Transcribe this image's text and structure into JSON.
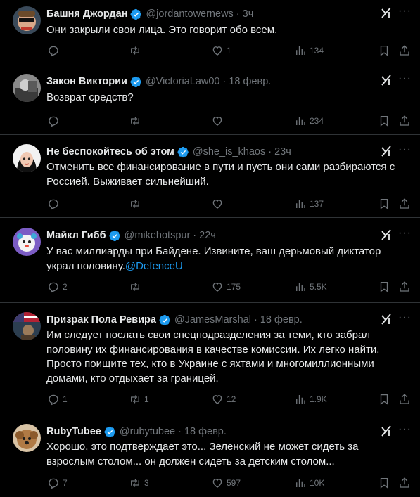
{
  "accent": "#1d9bf0",
  "muted": "#71767b",
  "tweets": [
    {
      "name": "Башня Джордан",
      "handle": "@jordantowernews",
      "time": "3ч",
      "text": "Они закрыли свои лица. Это говорит обо всем.",
      "mention": "",
      "replies": "",
      "retweets": "",
      "likes": "1",
      "views": "134"
    },
    {
      "name": "Закон Виктории",
      "handle": "@VictoriaLaw00",
      "time": "18 февр.",
      "text": "Возврат средств?",
      "mention": "",
      "replies": "",
      "retweets": "",
      "likes": "",
      "views": "234"
    },
    {
      "name": "Не беспокойтесь об этом",
      "handle": "@she_is_khaos",
      "time": "23ч",
      "text": "Отменить все финансирование в пути и пусть они сами разбираются с Россией. Выживает сильнейший.",
      "mention": "",
      "replies": "",
      "retweets": "",
      "likes": "",
      "views": "137"
    },
    {
      "name": "Майкл Гибб",
      "handle": "@mikehotspur",
      "time": "22ч",
      "text": "У вас миллиарды при Байдене. Извините, ваш дерьмовый диктатор украл половину.",
      "mention": "@DefenceU",
      "replies": "2",
      "retweets": "",
      "likes": "175",
      "views": "5.5K"
    },
    {
      "name": "Призрак Пола Ревира",
      "handle": "@JamesMarshal",
      "time": "18 февр.",
      "text": "Им следует послать свои спецподразделения за теми, кто забрал половину их финансирования в качестве комиссии. Их легко найти. Просто поищите тех, кто в Украине с яхтами и многомиллионными домами, кто отдыхает за границей.",
      "mention": "",
      "replies": "1",
      "retweets": "1",
      "likes": "12",
      "views": "1.9K"
    },
    {
      "name": "RubyTubee",
      "handle": "@rubytubee",
      "time": "18 февр.",
      "text": "Хорошо, это подтверждает это... Зеленский не может сидеть за взрослым столом... он должен сидеть за детским столом...",
      "mention": "",
      "replies": "7",
      "retweets": "3",
      "likes": "597",
      "views": "10K"
    }
  ]
}
